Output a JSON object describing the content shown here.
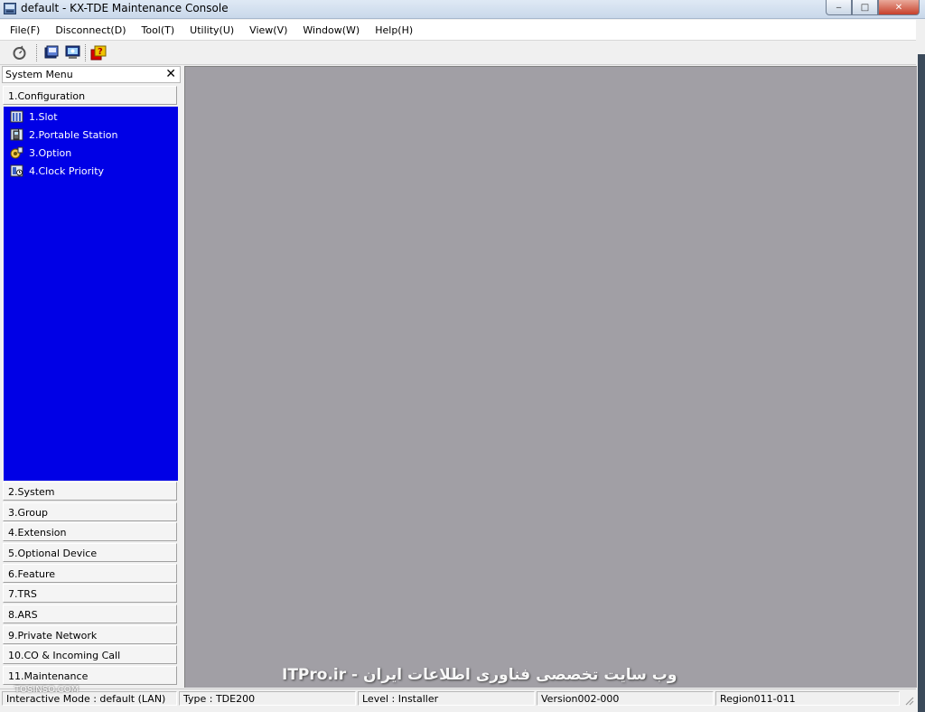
{
  "window": {
    "title": "default - KX-TDE Maintenance Console",
    "close_glyph": "✕",
    "min_glyph": "‒",
    "max_glyph": "□"
  },
  "menubar": {
    "items": [
      "File(F)",
      "Disconnect(D)",
      "Tool(T)",
      "Utility(U)",
      "View(V)",
      "Window(W)",
      "Help(H)"
    ]
  },
  "toolbar": {
    "icons": [
      "connect-icon",
      "station-icon",
      "monitor-icon",
      "help-icon"
    ]
  },
  "system_menu": {
    "title": "System Menu",
    "close_glyph": "✕",
    "active_group": "1.Configuration",
    "config_items": [
      {
        "label": "1.Slot",
        "icon": "slot-icon"
      },
      {
        "label": "2.Portable Station",
        "icon": "portable-station-icon"
      },
      {
        "label": "3.Option",
        "icon": "option-icon"
      },
      {
        "label": "4.Clock Priority",
        "icon": "clock-priority-icon"
      }
    ],
    "groups": [
      "2.System",
      "3.Group",
      "4.Extension",
      "5.Optional Device",
      "6.Feature",
      "7.TRS",
      "8.ARS",
      "9.Private Network",
      "10.CO & Incoming Call",
      "11.Maintenance"
    ]
  },
  "watermark": {
    "text": "ITPro.ir - وب سایت تخصصی فناوری اطلاعات ایران",
    "secondary": "TOSINSO.COM"
  },
  "statusbar": {
    "mode": "Interactive Mode : default (LAN)",
    "type": "Type : TDE200",
    "level": "Level : Installer",
    "version": "Version002-000",
    "region": "Region011-011"
  },
  "colors": {
    "config_highlight": "#0000e6",
    "mdi_background": "#a19fa5"
  }
}
